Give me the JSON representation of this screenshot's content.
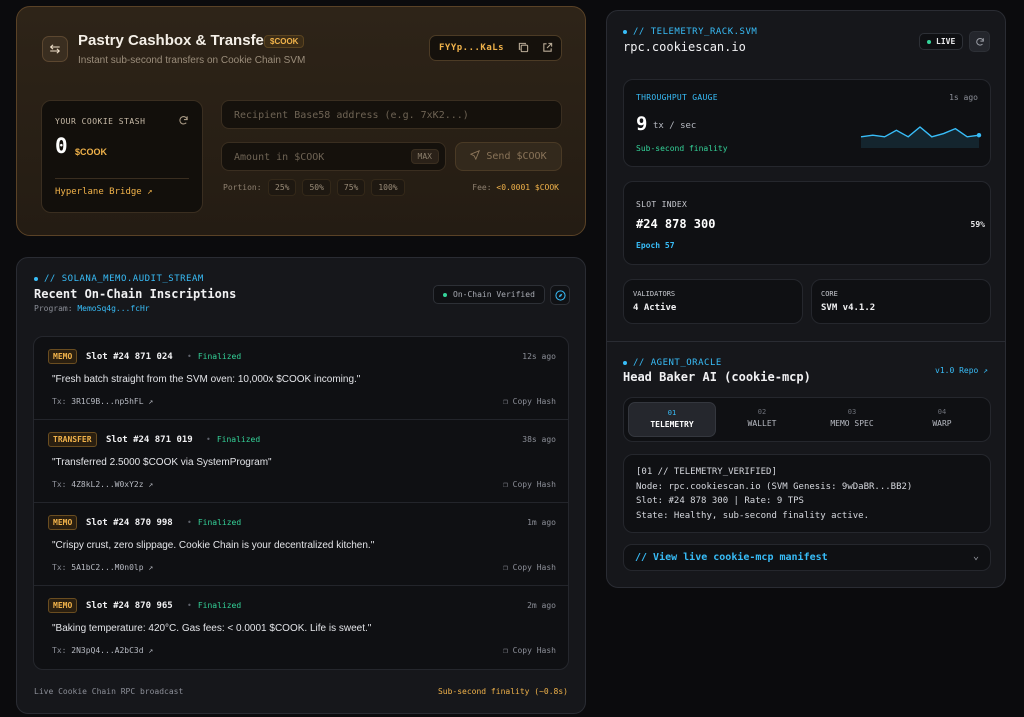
{
  "cashbox": {
    "title": "Pastry Cashbox & Transfer",
    "token_tag": "$COOK",
    "subtitle": "Instant sub-second transfers on Cookie Chain SVM",
    "wallet_address": "FYYp...KaLs",
    "stash_label": "YOUR COOKIE STASH",
    "stash_amount": "0",
    "stash_unit": "$COOK",
    "bridge_link": "Hyperlane Bridge ↗",
    "recipient_placeholder": "Recipient Base58 address (e.g. 7xK2...)",
    "amount_placeholder": "Amount in $COOK",
    "max_label": "MAX",
    "send_label": "Send $COOK",
    "portion_label": "Portion:",
    "portions": [
      "25%",
      "50%",
      "75%",
      "100%"
    ],
    "fee_label": "Fee:",
    "fee_value": "<0.0001 $COOK"
  },
  "memo": {
    "section_tag": "// SOLANA_MEMO.AUDIT_STREAM",
    "title": "Recent On-Chain Inscriptions",
    "program_label": "Program:",
    "program_id": "MemoSq4g...fcHr",
    "verified_label": "On-Chain Verified",
    "items": [
      {
        "badge": "MEMO",
        "slot": "Slot #24 871 024",
        "status": "Finalized",
        "ago": "12s ago",
        "message": "\"Fresh batch straight from the SVM oven: 10,000x $COOK incoming.\"",
        "tx_label": "Tx:",
        "tx": "3R1C9B...np5hFL",
        "copy": "Copy Hash"
      },
      {
        "badge": "TRANSFER",
        "slot": "Slot #24 871 019",
        "status": "Finalized",
        "ago": "38s ago",
        "message": "\"Transferred 2.5000 $COOK via SystemProgram\"",
        "tx_label": "Tx:",
        "tx": "4Z8kL2...W0xY2z",
        "copy": "Copy Hash"
      },
      {
        "badge": "MEMO",
        "slot": "Slot #24 870 998",
        "status": "Finalized",
        "ago": "1m ago",
        "message": "\"Crispy crust, zero slippage. Cookie Chain is your decentralized kitchen.\"",
        "tx_label": "Tx:",
        "tx": "5A1bC2...M0n0lp",
        "copy": "Copy Hash"
      },
      {
        "badge": "MEMO",
        "slot": "Slot #24 870 965",
        "status": "Finalized",
        "ago": "2m ago",
        "message": "\"Baking temperature: 420°C. Gas fees: < 0.0001 $COOK. Life is sweet.\"",
        "tx_label": "Tx:",
        "tx": "2N3pQ4...A2bC3d",
        "copy": "Copy Hash"
      }
    ],
    "footer_left": "Live Cookie Chain RPC broadcast",
    "footer_right": "Sub-second finality (~0.8s)"
  },
  "telemetry": {
    "section_tag": "// TELEMETRY_RACK.SVM",
    "host": "rpc.cookiescan.io",
    "live_label": "LIVE",
    "gauge_label": "THROUGHPUT GAUGE",
    "gauge_time": "1s ago",
    "gauge_value": "9",
    "gauge_unit": "tx / sec",
    "gauge_sub": "Sub-second finality",
    "sparkline": [
      5,
      6,
      5,
      9,
      5,
      11,
      5,
      7,
      10,
      5,
      6
    ],
    "slot_label": "SLOT INDEX",
    "slot_value": "#24 878 300",
    "slot_pct": "59%",
    "epoch": "Epoch 57",
    "validators_label": "VALIDATORS",
    "validators_value": "4 Active",
    "core_label": "CORE",
    "core_value": "SVM v4.1.2"
  },
  "oracle": {
    "section_tag": "// AGENT_ORACLE",
    "title": "Head Baker AI (cookie-mcp)",
    "repo_link": "v1.0 Repo ↗",
    "tabs": [
      {
        "num": "01",
        "label": "TELEMETRY"
      },
      {
        "num": "02",
        "label": "WALLET"
      },
      {
        "num": "03",
        "label": "MEMO SPEC"
      },
      {
        "num": "04",
        "label": "WARP"
      }
    ],
    "terminal": [
      "[01 // TELEMETRY_VERIFIED]",
      "Node: rpc.cookiescan.io (SVM Genesis: 9wDaBR...BB2)",
      "Slot: #24 878 300 | Rate: 9 TPS",
      "State: Healthy, sub-second finality active."
    ],
    "manifest_link": "// View live cookie-mcp manifest"
  },
  "colors": {
    "accent_gold": "#f0b24a",
    "accent_cyan": "#38bdf8",
    "success": "#34d399"
  }
}
